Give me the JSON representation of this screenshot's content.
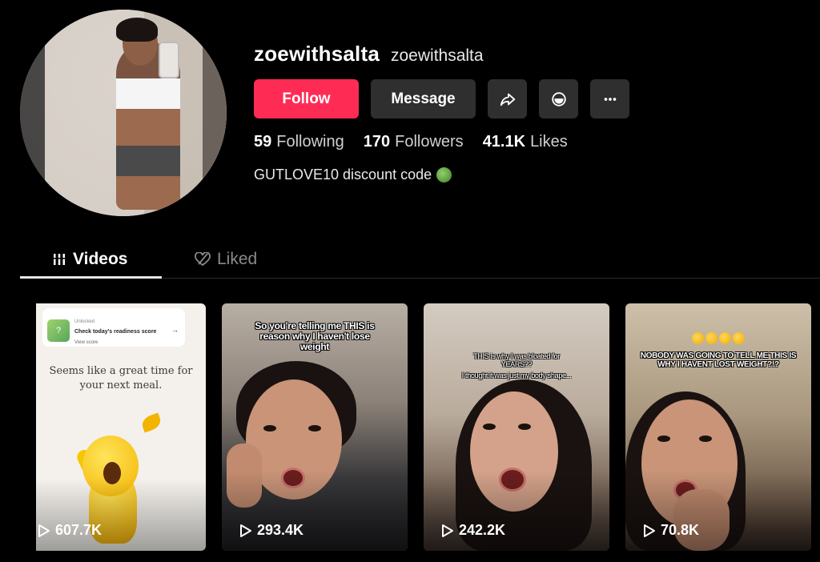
{
  "profile": {
    "username": "zoewithsalta",
    "nickname": "zoewithsalta",
    "bio": "GUTLOVE10 discount code"
  },
  "actions": {
    "follow_label": "Follow",
    "message_label": "Message",
    "share_icon": "share-icon",
    "repost_icon": "repost-icon",
    "more_icon": "more-icon"
  },
  "stats": [
    {
      "value": "59",
      "label": "Following"
    },
    {
      "value": "170",
      "label": "Followers"
    },
    {
      "value": "41.1K",
      "label": "Likes"
    }
  ],
  "tabs": [
    {
      "label": "Videos",
      "icon": "grid-bars-icon",
      "active": true
    },
    {
      "label": "Liked",
      "icon": "heart-lock-icon",
      "active": false
    }
  ],
  "videos": [
    {
      "views": "607.7K",
      "notif_top": "Unlocked",
      "notif_title": "Check today's readiness score",
      "notif_sub": "View score",
      "caption": "Seems like a great time for your next meal."
    },
    {
      "views": "293.4K",
      "caption": "So you're telling me THIS is reason why I haven't lose weight"
    },
    {
      "views": "242.2K",
      "caption_line1": "THIS is why I was bloated for YEARS??",
      "caption_line2": "I thought it was just my body shape..."
    },
    {
      "views": "70.8K",
      "caption": "NOBODY WAS GOING TO TELL ME THIS IS WHY I HAVENT LOST WEIGHT?!?"
    }
  ],
  "colors": {
    "accent": "#fe2c55",
    "background": "#000000",
    "button_secondary": "#2f2f2f"
  }
}
